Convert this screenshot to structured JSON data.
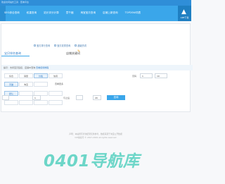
{
  "topbar": {
    "text": "欢迎访问站长工具 · 查询平台"
  },
  "nav": {
    "items": [
      "SEO综合查询",
      "权重查询",
      "站长评分计算",
      "意千缩",
      "淘宝宝贝查询",
      "店铺上新查询",
      "TOP20W词表"
    ],
    "apk_label": "APP下载"
  },
  "quick_links": [
    "宝贝排行查询",
    "宝贝权重查询",
    "超级热词"
  ],
  "tabs": {
    "active": "宝贝排名查询",
    "other": "店铺关键词"
  },
  "hint": {
    "text": "提示：支持宝贝链接、店铺ID查询",
    "highlight": "查看使用教程"
  },
  "filters": {
    "row1": [
      "综合",
      "销量",
      "价格",
      "信用"
    ],
    "row2": [
      "天猫",
      "淘宝",
      "",
      "查看更多"
    ],
    "row3": [
      "默认",
      "",
      "",
      ""
    ],
    "row4": [
      "",
      "",
      "",
      ""
    ],
    "page_label": "页码",
    "page_from": "1",
    "page_to": "10",
    "range_input": "1",
    "compare_label": "与之后",
    "count_value": "20",
    "submit_label": "查询"
  },
  "footer": {
    "line1": "声明：本站所有查询结果仅供参考，数据来源于淘宝公开数据",
    "line2": "ICP备案号 © 2017-2019 all rights reserved"
  },
  "watermark": "0401导航库"
}
